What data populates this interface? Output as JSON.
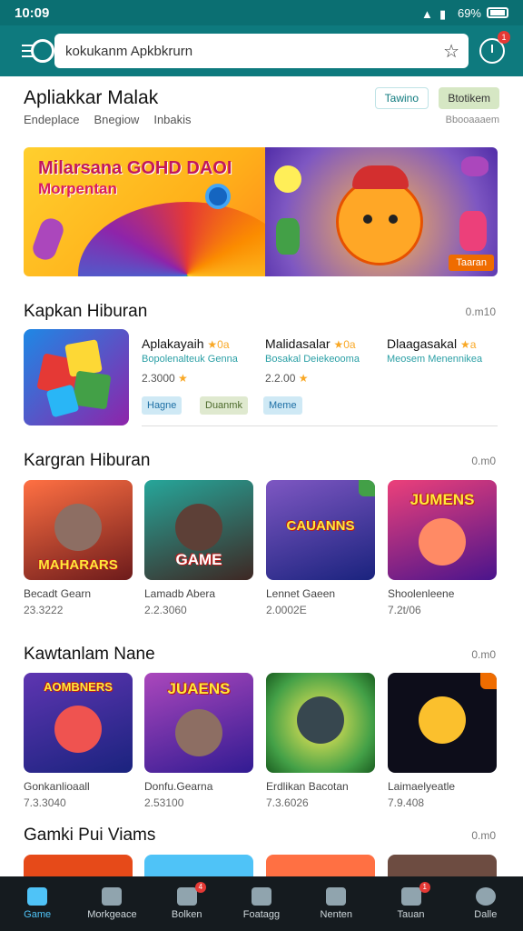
{
  "status_bar": {
    "time": "10:09",
    "battery": "69%"
  },
  "app_bar": {
    "search_value": "kokukanm Apkbkrurn",
    "notification_count": "1"
  },
  "header": {
    "title": "Apliakkar Malak",
    "subtitles": [
      "Endeplace",
      "Bnegiow",
      "Inbakis"
    ],
    "chip_1": "Tawino",
    "chip_2": "Btotikem",
    "chip_2_sub": "Bbooaaaem"
  },
  "banner": {
    "line_1": "Milarsana GOHD DAOI",
    "line_2": "Morpentan",
    "button": "Taaran"
  },
  "section_1": {
    "title": "Kapkan Hiburan",
    "more": "0.m10",
    "apps": [
      {
        "name": "Aplakayaih",
        "stars": "★0a",
        "desc": "Bopolenalteuk Genna",
        "rating": "2.3000",
        "tag": "Hagne"
      },
      {
        "name": "Malidasalar",
        "stars": "★0a",
        "desc": "Bosakal Deiekeooma",
        "rating": "2.2.00",
        "tag": "Duanmk"
      },
      {
        "name": "Dlaagasakal",
        "stars": "★a",
        "desc": "Meosem Menennikea",
        "rating": "",
        "tag": "Meme"
      }
    ]
  },
  "section_2": {
    "title": "Kargran Hiburan",
    "more": "0.m0",
    "cards": [
      {
        "label": "MAHARARS",
        "name": "Becadt Gearn",
        "meta": "23.3222"
      },
      {
        "label": "GAME",
        "name": "Lamadb Abera",
        "meta": "2.2.3060"
      },
      {
        "label": "CAUANNS",
        "name": "Lennet Gaeen",
        "meta": "2.0002E"
      },
      {
        "label": "JUMENS",
        "name": "Shoolenleene",
        "meta": "7.2t/06"
      }
    ]
  },
  "section_3": {
    "title": "Kawtanlam Nane",
    "more": "0.m0",
    "cards": [
      {
        "label": "AOMBNERS",
        "name": "Gonkanlioaall",
        "meta": "7.3.3040"
      },
      {
        "label": "JUAENS",
        "name": "Donfu.Gearna",
        "meta": "2.53100"
      },
      {
        "label": "",
        "name": "Erdlikan Bacotan",
        "meta": "7.3.6026"
      },
      {
        "label": "",
        "name": "Laimaelyeatle",
        "meta": "7.9.408"
      }
    ]
  },
  "section_4": {
    "title": "Gamki Pui Viams",
    "more": "0.m0"
  },
  "bottom_nav": [
    {
      "label": "Game",
      "active": true,
      "badge": ""
    },
    {
      "label": "Morkgeace",
      "active": false,
      "badge": ""
    },
    {
      "label": "Bolken",
      "active": false,
      "badge": "4"
    },
    {
      "label": "Foatagg",
      "active": false,
      "badge": ""
    },
    {
      "label": "Nenten",
      "active": false,
      "badge": ""
    },
    {
      "label": "Tauan",
      "active": false,
      "badge": "1"
    },
    {
      "label": "Dalle",
      "active": false,
      "badge": ""
    }
  ],
  "colors": {
    "brand": "#0e7a7e",
    "nav_bg": "#151b1f",
    "active": "#4fc3f7"
  }
}
